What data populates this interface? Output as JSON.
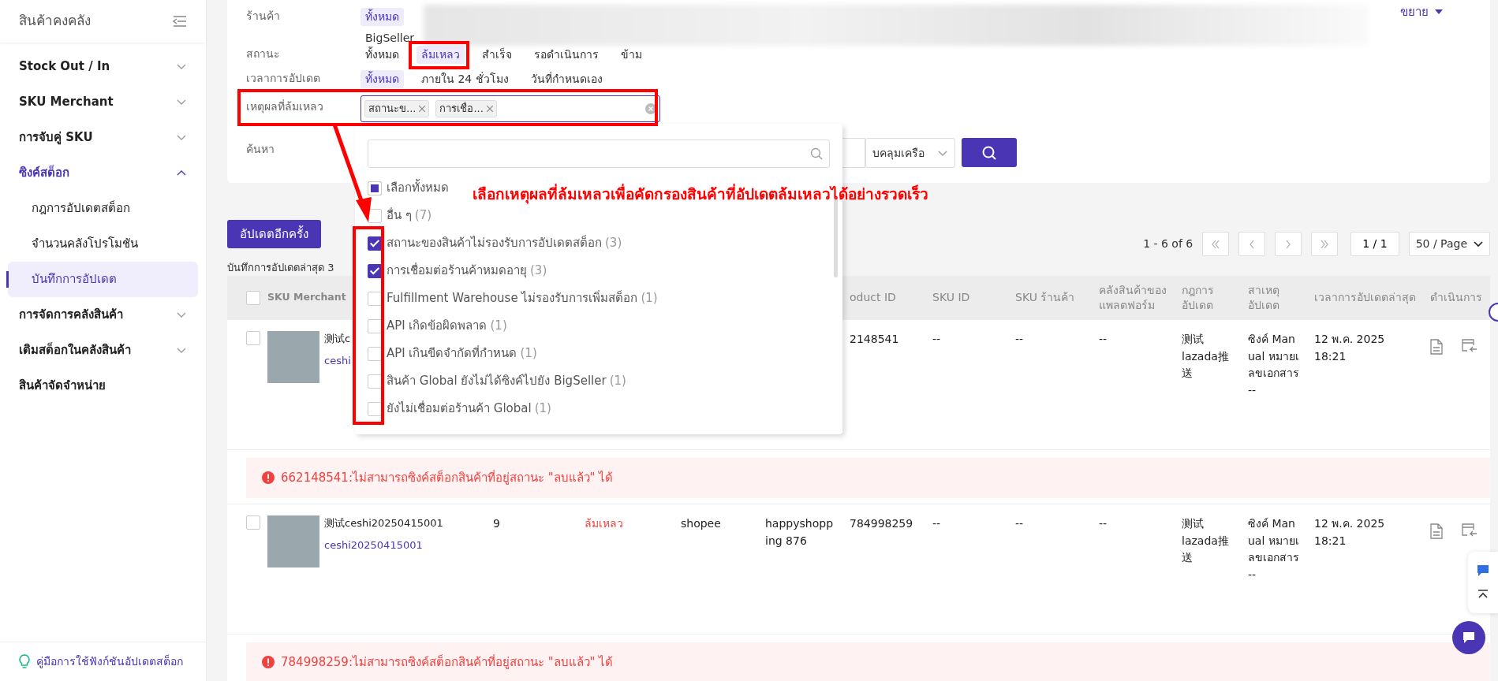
{
  "sidebar": {
    "title": "สินค้าคงคลัง",
    "items": [
      {
        "label": "Stock Out / In",
        "kind": "group",
        "expanded": false
      },
      {
        "label": "SKU Merchant",
        "kind": "group",
        "expanded": false
      },
      {
        "label": "การจับคู่ SKU",
        "kind": "group",
        "expanded": false
      },
      {
        "label": "ซิงค์สต็อก",
        "kind": "group",
        "expanded": true,
        "children": [
          {
            "label": "กฎการอัปเดตสต็อก",
            "selected": false
          },
          {
            "label": "จำนวนคลังโปรโมชัน",
            "selected": false
          },
          {
            "label": "บันทึกการอัปเดต",
            "selected": true
          }
        ]
      },
      {
        "label": "การจัดการคลังสินค้า",
        "kind": "group",
        "expanded": false
      },
      {
        "label": "เติมสต็อกในคลังสินค้า",
        "kind": "group",
        "expanded": false
      },
      {
        "label": "สินค้าจัดจำหน่าย",
        "kind": "link"
      }
    ],
    "help_link": "คู่มือการใช้ฟังก์ชันอัปเดตสต็อก"
  },
  "filters": {
    "expand_label": "ขยาย",
    "rows": [
      {
        "label": "ร้านค้า",
        "kind": "options",
        "redacted": true,
        "options": [
          {
            "label": "ทั้งหมด",
            "selected": true
          },
          {
            "label": "BigSeller",
            "selected": false
          }
        ]
      },
      {
        "label": "สถานะ",
        "kind": "options",
        "redacted": false,
        "options": [
          {
            "label": "ทั้งหมด",
            "selected": false
          },
          {
            "label": "ล้มเหลว",
            "selected": true
          },
          {
            "label": "สำเร็จ",
            "selected": false
          },
          {
            "label": "รอดำเนินการ",
            "selected": false
          },
          {
            "label": "ข้าม",
            "selected": false
          }
        ]
      },
      {
        "label": "เวลาการอัปเดต",
        "kind": "options",
        "redacted": false,
        "options": [
          {
            "label": "ทั้งหมด",
            "selected": true
          },
          {
            "label": "ภายใน 24 ชั่วโมง",
            "selected": false
          },
          {
            "label": "วันที่กำหนดเอง",
            "selected": false
          }
        ]
      },
      {
        "label": "เหตุผลที่ล้มเหลว",
        "kind": "tags",
        "tags": [
          "สถานะข...",
          "การเชื่อ..."
        ]
      },
      {
        "label": "ค้นหา",
        "kind": "search",
        "mode": "บคลุมเครือ"
      }
    ]
  },
  "dropdown": {
    "items": [
      {
        "label": "เลือกทั้งหมด",
        "kind": "select_all",
        "indeterminate": true
      },
      {
        "label": "อื่น ๆ",
        "count": "(7)",
        "checked": false
      },
      {
        "label": "สถานะของสินค้าไม่รองรับการอัปเดตสต็อก",
        "count": "(3)",
        "checked": true
      },
      {
        "label": "การเชื่อมต่อร้านค้าหมดอายุ",
        "count": "(3)",
        "checked": true
      },
      {
        "label": "Fulfillment Warehouse ไม่รองรับการเพิ่มสต็อก",
        "count": "(1)",
        "checked": false
      },
      {
        "label": "API เกิดข้อผิดพลาด",
        "count": "(1)",
        "checked": false
      },
      {
        "label": "API เกินขีดจำกัดที่กำหนด",
        "count": "(1)",
        "checked": false
      },
      {
        "label": "สินค้า Global ยังไม่ได้ซิงค์ไปยัง BigSeller",
        "count": "(1)",
        "checked": false
      },
      {
        "label": "ยังไม่เชื่อมต่อร้านค้า Global",
        "count": "(1)",
        "checked": false
      }
    ]
  },
  "annotation": {
    "text": "เลือกเหตุผลที่ล้มเหลวเพื่อคัดกรองสินค้าที่อัปเดตล้มเหลวได้อย่างรวดเร็ว"
  },
  "toolbar": {
    "update_button": "อัปเดตอีกครั้ง",
    "last_update": "บันทึกการอัปเดตล่าสุด 3",
    "range": "1 - 6 of 6",
    "page": "1 / 1",
    "page_size": "50 / Page"
  },
  "table": {
    "select_all": false,
    "header": {
      "sku_merchant": "SKU Merchant",
      "product_id": "oduct ID",
      "sku_id": "SKU ID",
      "shop_sku": "SKU ร้านค้า",
      "platform_warehouse": "คลังสินค้าของแพลตฟอร์ม",
      "update_rule": "กฎการอัปเดต",
      "update_reason": "สาเหตุอัปเดต",
      "update_time": "เวลาการอัปเดตล่าสุด",
      "actions": "ดำเนินการ"
    },
    "rows": [
      {
        "selected": false,
        "name": "测试c",
        "code": "ceshi",
        "product_id": "2148541",
        "sku_id": "--",
        "shop_sku": "--",
        "platform_warehouse": "--",
        "update_rule": "测试lazada推送",
        "update_reason": "ซิงค์ Manual หมายเลขเอกสาร --",
        "update_time": "12 พ.ค. 2025 18:21",
        "error": "662148541:ไม่สามารถซิงค์สต็อกสินค้าที่อยู่สถานะ \"ลบแล้ว\" ได้"
      },
      {
        "selected": false,
        "name": "测试ceshi20250415001",
        "code": "ceshi20250415001",
        "quantity": "9",
        "status": "ล้มเหลว",
        "platform": "shopee",
        "shop": "happyshopping 876",
        "product_id": "784998259",
        "sku_id": "--",
        "shop_sku": "--",
        "platform_warehouse": "--",
        "update_rule": "测试lazada推送",
        "update_reason": "ซิงค์ Manual หมายเลขเอกสาร --",
        "update_time": "12 พ.ค. 2025 18:21",
        "error": "784998259:ไม่สามารถซิงค์สต็อกสินค้าที่อยู่สถานะ \"ลบแล้ว\" ได้"
      }
    ]
  }
}
